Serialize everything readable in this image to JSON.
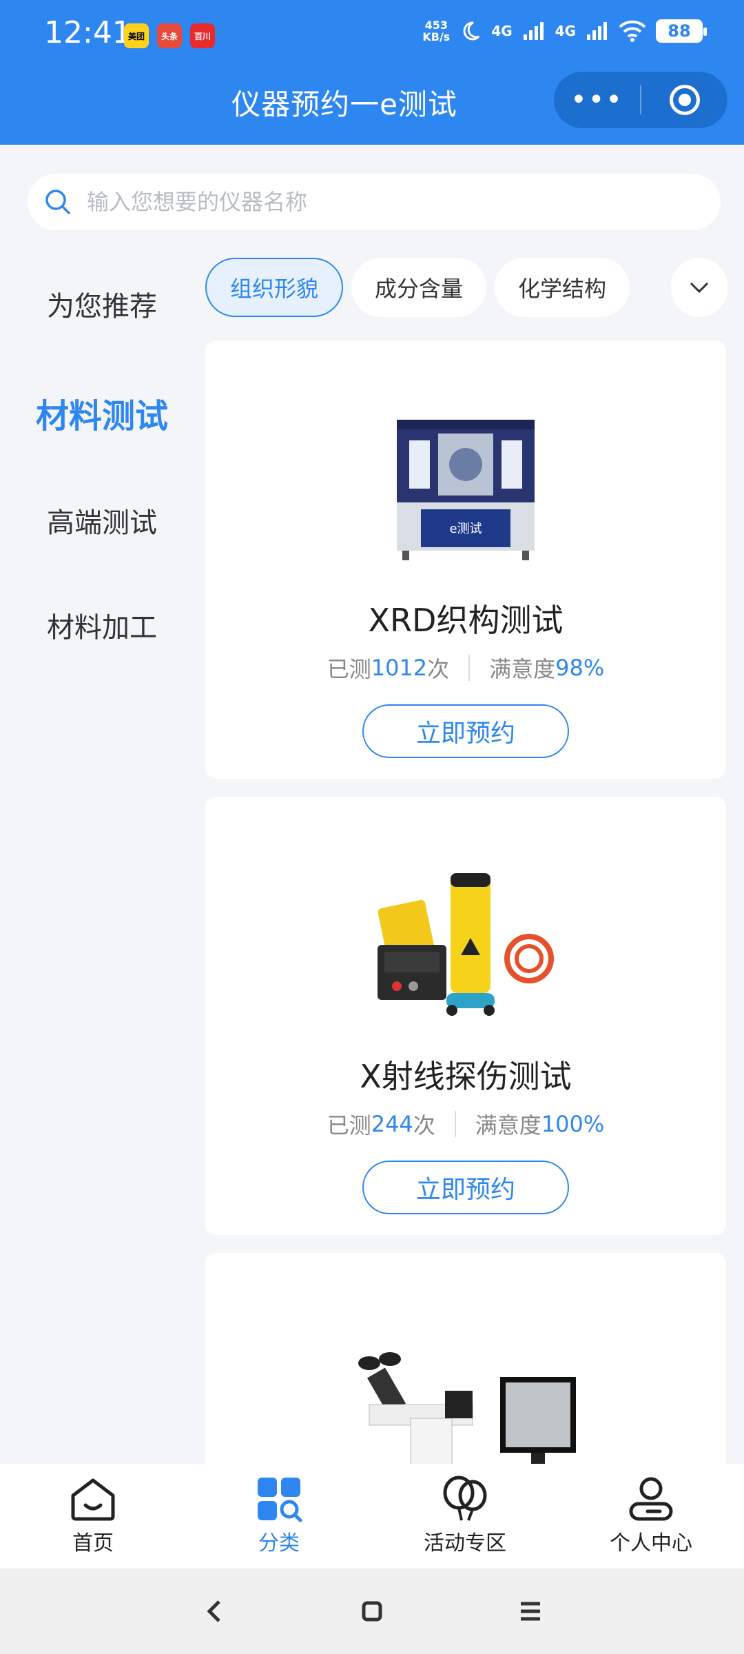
{
  "status_bar": {
    "time": "12:41",
    "app_icons": [
      "美团",
      "头条",
      "百川"
    ],
    "net_speed_top": "453",
    "net_speed_unit": "KB/s",
    "signal1": "4G",
    "signal2": "4G",
    "battery": "88"
  },
  "header": {
    "title": "仪器预约一e测试",
    "more_label": "•••"
  },
  "search": {
    "placeholder": "输入您想要的仪器名称"
  },
  "sidebar": {
    "items": [
      {
        "label": "为您推荐"
      },
      {
        "label": "材料测试"
      },
      {
        "label": "高端测试"
      },
      {
        "label": "材料加工"
      }
    ]
  },
  "chips": [
    {
      "label": "组织形貌"
    },
    {
      "label": "成分含量"
    },
    {
      "label": "化学结构"
    }
  ],
  "cards": [
    {
      "title": "XRD织构测试",
      "tested_prefix": "已测",
      "tested_count": "1012",
      "tested_suffix": "次",
      "satisfaction_label": "满意度",
      "satisfaction_value": "98%",
      "button": "立即预约"
    },
    {
      "title": "X射线探伤测试",
      "tested_prefix": "已测",
      "tested_count": "244",
      "tested_suffix": "次",
      "satisfaction_label": "满意度",
      "satisfaction_value": "100%",
      "button": "立即预约"
    }
  ],
  "tabbar": {
    "items": [
      {
        "label": "首页",
        "icon": "home-icon"
      },
      {
        "label": "分类",
        "icon": "category-icon"
      },
      {
        "label": "活动专区",
        "icon": "balloon-icon"
      },
      {
        "label": "个人中心",
        "icon": "user-icon"
      }
    ]
  },
  "colors": {
    "primary": "#2e87f1",
    "background": "#f3f5f9"
  }
}
